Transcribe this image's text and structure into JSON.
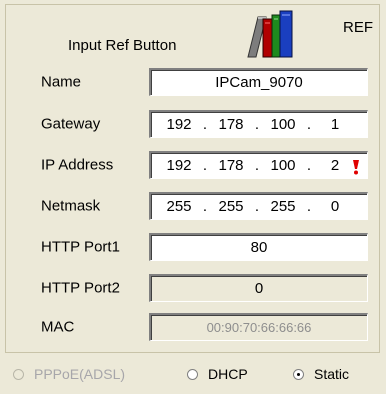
{
  "header": {
    "title": "Input Ref Button",
    "ref_label": "REF"
  },
  "fields": {
    "name": {
      "label": "Name",
      "value": "IPCam_9070"
    },
    "gateway": {
      "label": "Gateway",
      "value": [
        "192",
        "178",
        "100",
        "1"
      ]
    },
    "ip": {
      "label": "IP Address",
      "value": [
        "192",
        "178",
        "100",
        "2"
      ]
    },
    "netmask": {
      "label": "Netmask",
      "value": [
        "255",
        "255",
        "255",
        "0"
      ]
    },
    "http1": {
      "label": "HTTP Port1",
      "value": "80"
    },
    "http2": {
      "label": "HTTP Port2",
      "value": "0"
    },
    "mac": {
      "label": "MAC",
      "value": "00:90:70:66:66:66"
    }
  },
  "radios": {
    "pppoe": {
      "label": "PPPoE(ADSL)",
      "enabled": false,
      "checked": false
    },
    "dhcp": {
      "label": "DHCP",
      "enabled": true,
      "checked": false
    },
    "static": {
      "label": "Static",
      "enabled": true,
      "checked": true
    }
  },
  "icons": {
    "books": "books-icon",
    "warning": "exclamation-warning-icon"
  },
  "colors": {
    "background": "#ece9d8",
    "warning": "#e00000",
    "disabled_text": "#a7a6aa"
  }
}
